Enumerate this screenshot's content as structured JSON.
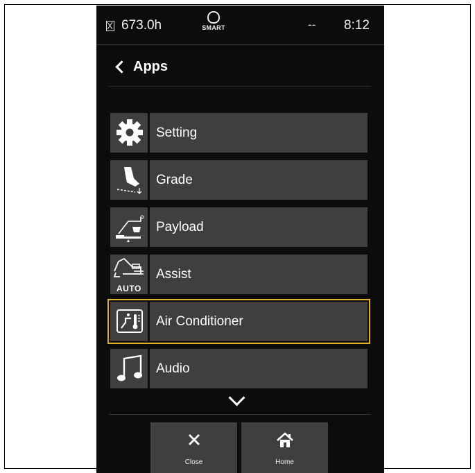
{
  "status": {
    "hours": "673.0h",
    "smart_label": "SMART",
    "dashes": "--",
    "time": "8:12"
  },
  "header": {
    "title": "Apps"
  },
  "menu": {
    "items": [
      {
        "label": "Setting",
        "icon": "gear-icon"
      },
      {
        "label": "Grade",
        "icon": "grade-icon"
      },
      {
        "label": "Payload",
        "icon": "payload-icon"
      },
      {
        "label": "Assist",
        "icon": "excavator-auto-icon",
        "badge": "AUTO"
      },
      {
        "label": "Air Conditioner",
        "icon": "air-conditioner-icon",
        "selected": true
      },
      {
        "label": "Audio",
        "icon": "music-note-icon"
      }
    ]
  },
  "footer": {
    "close_label": "Close",
    "home_label": "Home"
  },
  "colors": {
    "screen_bg": "#0c0c0c",
    "item_bg": "#3f3f3f",
    "selection": "#e0b028"
  }
}
